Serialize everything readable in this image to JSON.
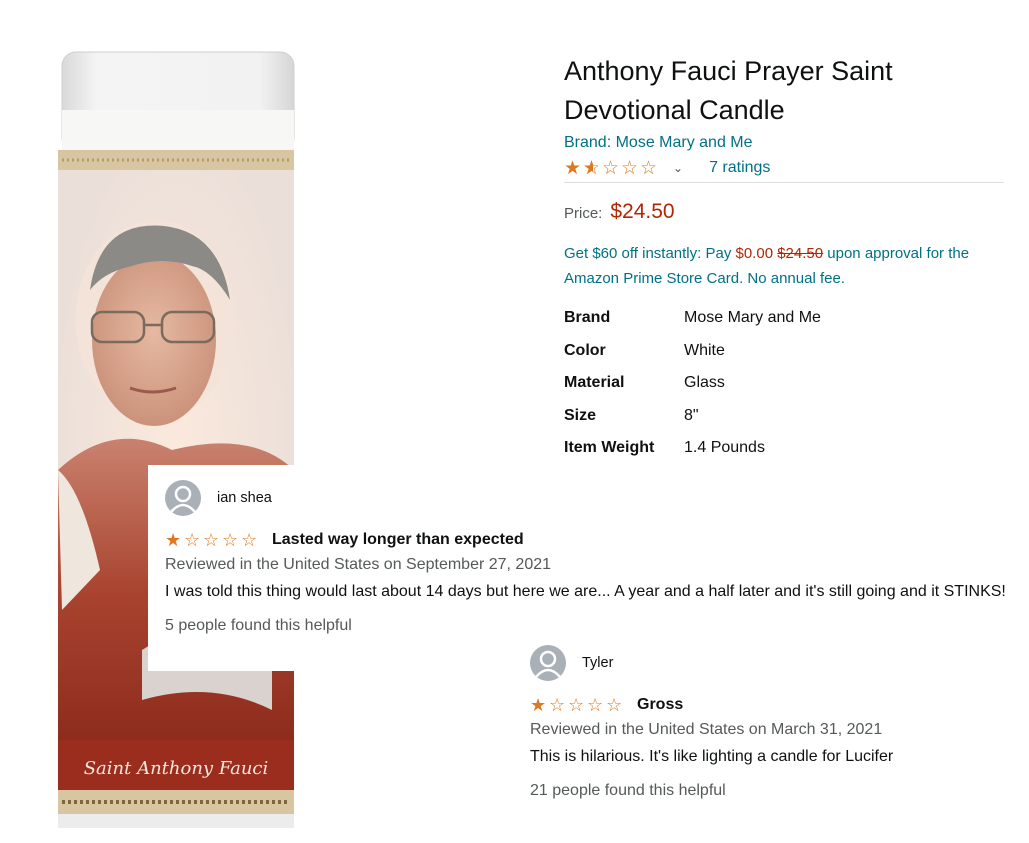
{
  "product": {
    "title": "Anthony Fauci Prayer Saint Devotional Candle",
    "brand_link": "Brand: Mose Mary and Me",
    "rating": {
      "value": 1.5,
      "out_of": 5,
      "count_text": "7 ratings",
      "chevron": "⌄"
    },
    "price": {
      "label": "Price:",
      "value": "$24.50"
    },
    "promo": {
      "prefix": "Get $60 off instantly: Pay ",
      "pay_price": "$0.00",
      "strike_price": "$24.50",
      "suffix": " upon approval for the Amazon Prime Store Card. No annual fee."
    },
    "specs": [
      {
        "label": "Brand",
        "value": "Mose Mary and Me"
      },
      {
        "label": "Color",
        "value": "White"
      },
      {
        "label": "Material",
        "value": "Glass"
      },
      {
        "label": "Size",
        "value": "8\""
      },
      {
        "label": "Item Weight",
        "value": "1.4 Pounds"
      }
    ],
    "image": {
      "caption": "Saint Anthony Fauci",
      "icon": "candle-product-image"
    }
  },
  "reviews": [
    {
      "reviewer": "ian shea",
      "stars": 1,
      "title": "Lasted way longer than expected",
      "date": "Reviewed in the United States on September 27, 2021",
      "body": "I was told this thing would last about 14 days but here we are... A year and a half later and it's still going and it STINKS!",
      "helpful": "5 people found this helpful"
    },
    {
      "reviewer": "Tyler",
      "stars": 1,
      "title": "Gross",
      "date": "Reviewed in the United States on March 31, 2021",
      "body": "This is hilarious. It's like lighting a candle for Lucifer",
      "helpful": "21 people found this helpful"
    }
  ],
  "colors": {
    "link": "#007185",
    "price": "#b12704",
    "star": "#de7921",
    "muted": "#565959"
  }
}
